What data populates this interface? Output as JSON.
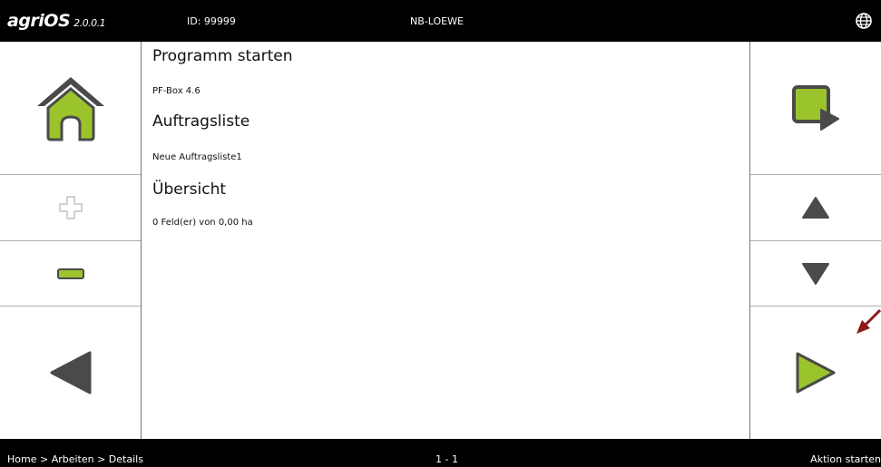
{
  "header": {
    "logo": "agriOS",
    "version": "2.0.0.1",
    "device_id": "ID: 99999",
    "device_name": "NB-LOEWE",
    "globe_icon": "globe-icon"
  },
  "content": {
    "sections": [
      {
        "title": "Programm starten",
        "value": "PF-Box 4.6"
      },
      {
        "title": "Auftragsliste",
        "value": "Neue Auftragsliste1"
      },
      {
        "title": "Übersicht",
        "value": "0 Feld(er) von 0,00 ha"
      }
    ]
  },
  "left_panel": {
    "home_icon": "home-icon",
    "plus_icon": "plus-icon",
    "minus_icon": "minus-icon",
    "back_icon": "triangle-left-icon"
  },
  "right_panel": {
    "select_icon": "square-pointer-icon",
    "up_icon": "triangle-up-icon",
    "down_icon": "triangle-down-icon",
    "start_icon": "triangle-right-icon"
  },
  "footer": {
    "breadcrumb": "Home > Arbeiten > Details",
    "page_indicator": "1 - 1",
    "action_label": "Aktion starten"
  },
  "colors": {
    "accent_green": "#9bc42c",
    "dark_grey": "#4a4a4a",
    "bar_black": "#000000"
  }
}
